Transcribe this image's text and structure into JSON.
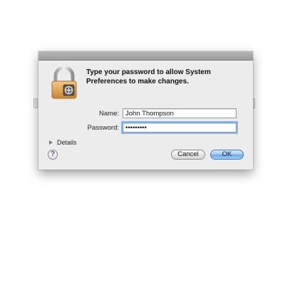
{
  "dialog": {
    "message": "Type your password to allow System Preferences to make changes.",
    "name_label": "Name:",
    "name_value": "John Thompson",
    "password_label": "Password:",
    "password_value": "•••••••••",
    "details_label": "Details",
    "help_glyph": "?",
    "cancel_label": "Cancel",
    "ok_label": "OK"
  },
  "icons": {
    "lock": "lock-icon",
    "disclosure": "disclosure-triangle-icon",
    "help": "help-icon"
  },
  "colors": {
    "dialog_bg": "#ececec",
    "focus_ring": "#8db6ec",
    "default_button": "#6aa8ec",
    "help_glyph": "#6b35a6"
  }
}
